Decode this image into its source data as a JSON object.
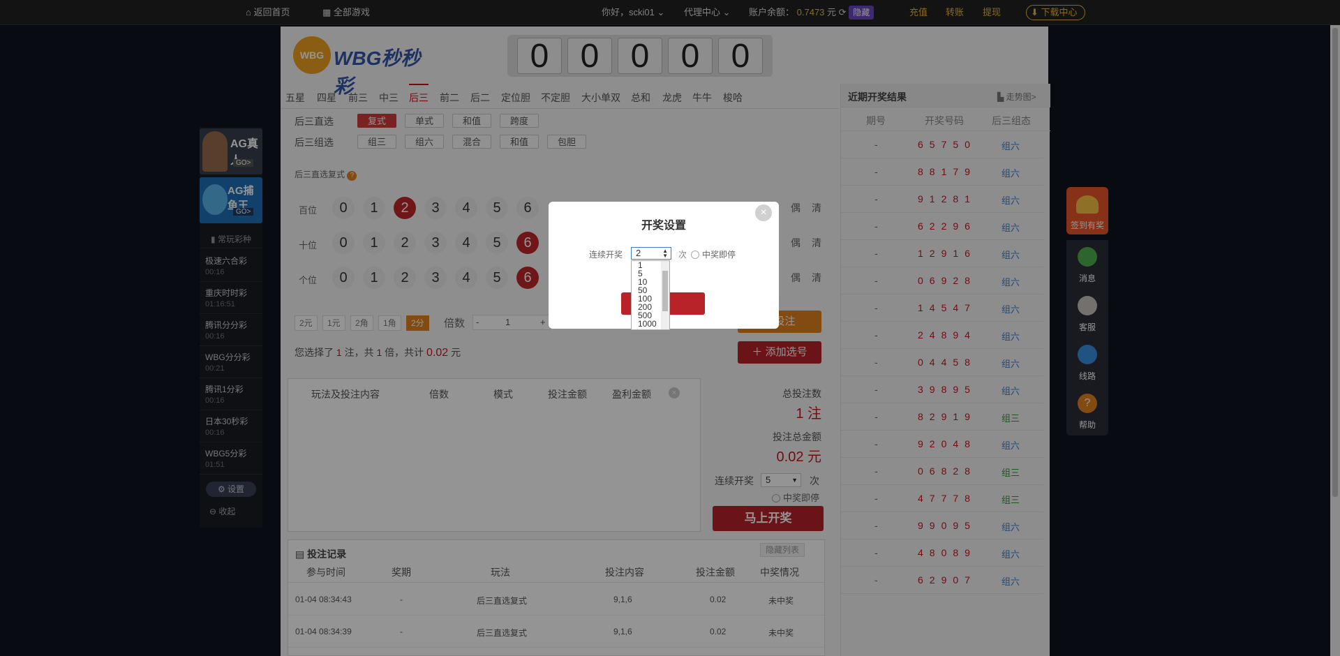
{
  "topbar": {
    "home": "返回首页",
    "all_games": "全部游戏",
    "greeting": "你好，scki01",
    "agent": "代理中心",
    "balance_label": "账户余额：",
    "balance_value": "0.7473",
    "balance_unit": "元",
    "hide": "隐藏",
    "recharge": "充值",
    "transfer": "转账",
    "withdraw": "提现",
    "download": "下载中心"
  },
  "logo": {
    "text": "WBG秒秒彩",
    "badge": "WBG"
  },
  "counter": [
    "0",
    "0",
    "0",
    "0",
    "0"
  ],
  "tabs": [
    "五星",
    "四星",
    "前三",
    "中三",
    "后三",
    "前二",
    "后二",
    "定位胆",
    "不定胆",
    "大小单双",
    "总和",
    "龙虎",
    "牛牛",
    "梭哈"
  ],
  "subplays": {
    "row1_label": "后三直选",
    "row1": [
      "复式",
      "单式",
      "和值",
      "跨度"
    ],
    "row2_label": "后三组选",
    "row2": [
      "组三",
      "组六",
      "混合",
      "和值",
      "包胆"
    ]
  },
  "play_title": "后三直选复式",
  "positions": [
    {
      "label": "百位",
      "selected": "2"
    },
    {
      "label": "十位",
      "selected": "6"
    },
    {
      "label": "个位",
      "selected": "6"
    }
  ],
  "digits": [
    "0",
    "1",
    "2",
    "3",
    "4",
    "5",
    "6"
  ],
  "side_btns": {
    "even": "偶",
    "clear": "清"
  },
  "modes": [
    "2元",
    "1元",
    "2角",
    "1角",
    "2分"
  ],
  "multiplier": {
    "label": "倍数",
    "minus": "-",
    "value": "1",
    "plus": "+"
  },
  "summary": {
    "t1": "您选择了",
    "count": "1",
    "t2": "注，共",
    "mult": "1",
    "t3": "倍，共计",
    "amount": "0.02",
    "t4": "元"
  },
  "buttons": {
    "bet_now_partial": "速投注",
    "add": "添加选号",
    "open_now": "马上开奖"
  },
  "cart_headers": [
    "玩法及投注内容",
    "倍数",
    "模式",
    "投注金额",
    "盈利金额"
  ],
  "right_panel": {
    "total_bets_label": "总投注数",
    "total_bets_value": "1 注",
    "total_amount_label": "投注总金额",
    "total_amount_value": "0.02 元",
    "cont_label": "连续开奖",
    "cont_value": "5",
    "cont_unit": "次",
    "stop_label": "中奖即停"
  },
  "records": {
    "title": "投注记录",
    "hide_list": "隐藏列表",
    "headers": [
      "参与时间",
      "奖期",
      "玩法",
      "投注内容",
      "投注金额",
      "中奖情况"
    ],
    "rows": [
      {
        "time": "01-04 08:34:43",
        "period": "-",
        "play": "后三直选复式",
        "content": "9,1,6",
        "amount": "0.02",
        "status": "未中奖"
      },
      {
        "time": "01-04 08:34:39",
        "period": "-",
        "play": "后三直选复式",
        "content": "9,1,6",
        "amount": "0.02",
        "status": "未中奖"
      }
    ]
  },
  "recent": {
    "title": "近期开奖结果",
    "trend": "走势图>",
    "headers": [
      "期号",
      "开奖号码",
      "后三组态"
    ],
    "rows": [
      {
        "p": "-",
        "n": "65750",
        "f": "组六"
      },
      {
        "p": "-",
        "n": "88179",
        "f": "组六"
      },
      {
        "p": "-",
        "n": "91281",
        "f": "组六"
      },
      {
        "p": "-",
        "n": "62296",
        "f": "组六"
      },
      {
        "p": "-",
        "n": "12916",
        "f": "组六"
      },
      {
        "p": "-",
        "n": "06928",
        "f": "组六"
      },
      {
        "p": "-",
        "n": "14547",
        "f": "组六"
      },
      {
        "p": "-",
        "n": "24894",
        "f": "组六"
      },
      {
        "p": "-",
        "n": "04458",
        "f": "组六"
      },
      {
        "p": "-",
        "n": "39895",
        "f": "组六"
      },
      {
        "p": "-",
        "n": "82919",
        "f": "组三"
      },
      {
        "p": "-",
        "n": "92048",
        "f": "组六"
      },
      {
        "p": "-",
        "n": "06828",
        "f": "组三"
      },
      {
        "p": "-",
        "n": "47778",
        "f": "组三"
      },
      {
        "p": "-",
        "n": "99095",
        "f": "组六"
      },
      {
        "p": "-",
        "n": "48089",
        "f": "组六"
      },
      {
        "p": "-",
        "n": "62907",
        "f": "组六"
      }
    ]
  },
  "left_sidebar": {
    "ag_live": "AG真人",
    "ag_fish": "AG捕鱼王",
    "go": "GO>",
    "common": "常玩彩种",
    "games": [
      {
        "name": "极速六合彩",
        "time": "00:16"
      },
      {
        "name": "重庆时时彩",
        "time": "01:16:51"
      },
      {
        "name": "腾讯分分彩",
        "time": "00:16"
      },
      {
        "name": "WBG分分彩",
        "time": "00:21"
      },
      {
        "name": "腾讯1分彩",
        "time": "00:16"
      },
      {
        "name": "日本30秒彩",
        "time": "00:16"
      },
      {
        "name": "WBG5分彩",
        "time": "01:51"
      }
    ],
    "settings": "设置",
    "collapse": "收起"
  },
  "right_side": {
    "checkin": "签到有奖",
    "message": "消息",
    "service": "客服",
    "route": "线路",
    "help": "帮助"
  },
  "modal": {
    "title": "开奖设置",
    "label": "连续开奖",
    "selected": "2",
    "unit": "次",
    "stop": "中奖即停",
    "confirm_partial": "定",
    "options": [
      "1",
      "5",
      "10",
      "50",
      "100",
      "200",
      "500",
      "1000"
    ]
  }
}
